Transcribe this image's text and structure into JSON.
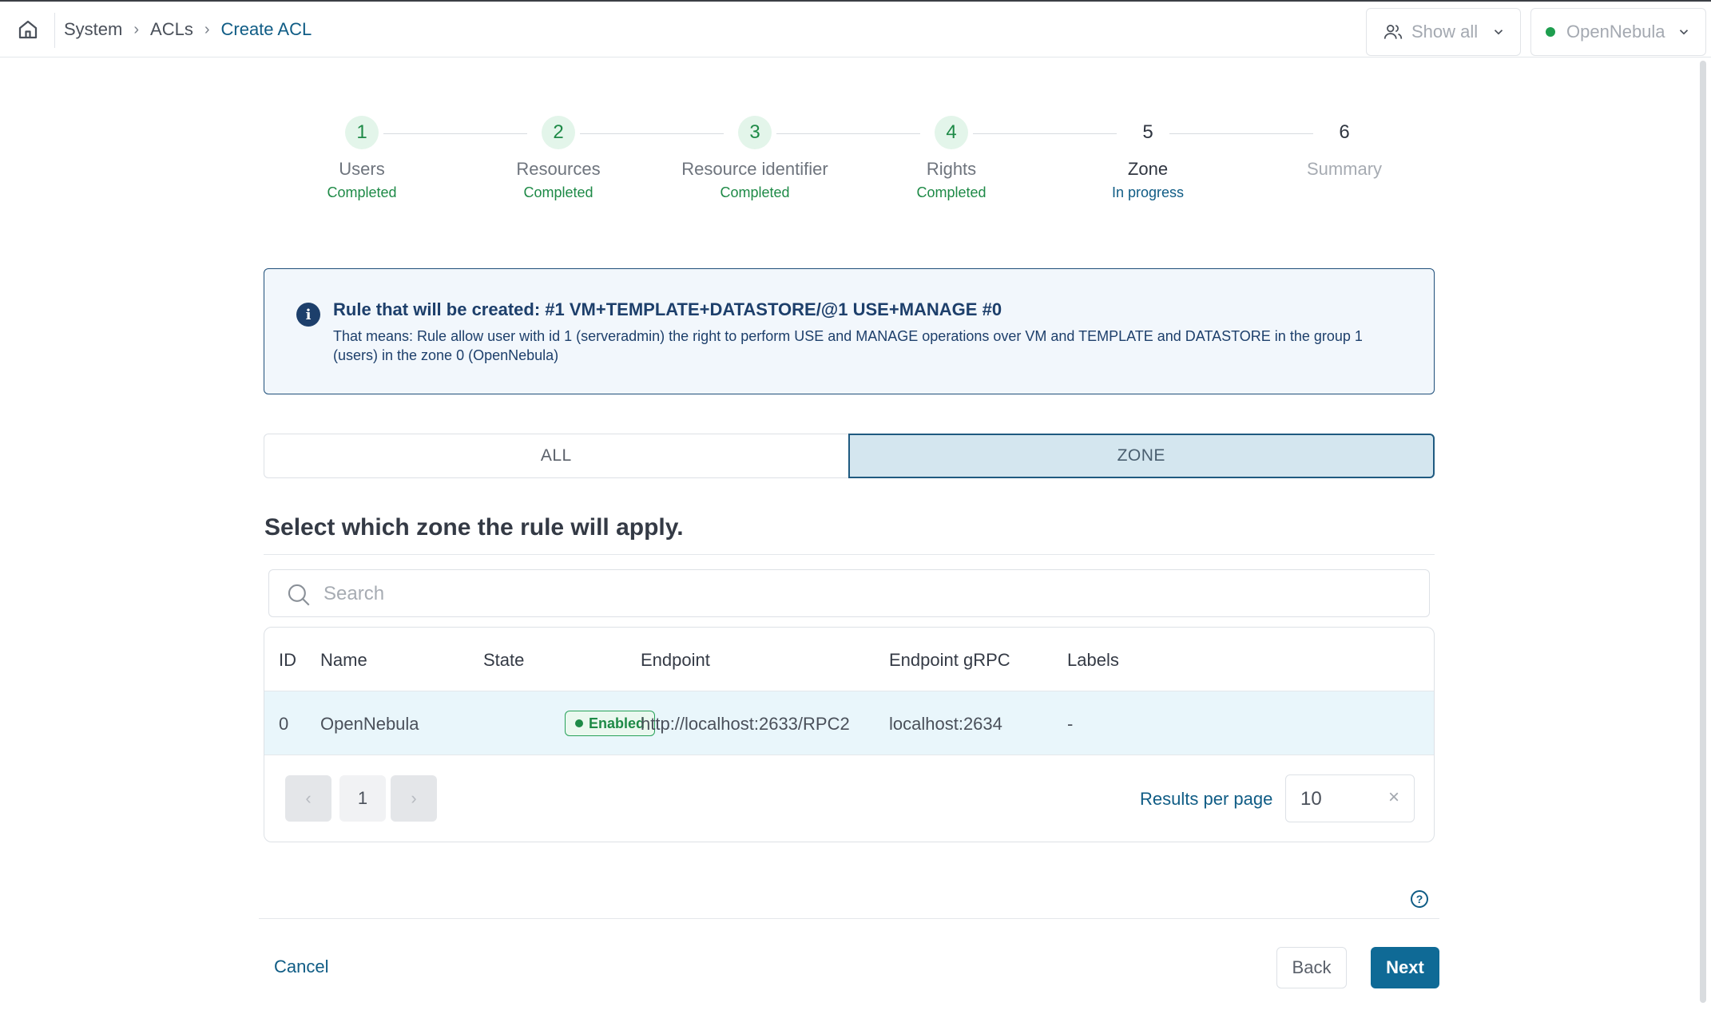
{
  "breadcrumb": {
    "items": [
      "System",
      "ACLs",
      "Create ACL"
    ]
  },
  "header": {
    "show_all": "Show all",
    "zone": "OpenNebula"
  },
  "steps": [
    {
      "num": "1",
      "title": "Users",
      "status": "Completed"
    },
    {
      "num": "2",
      "title": "Resources",
      "status": "Completed"
    },
    {
      "num": "3",
      "title": "Resource identifier",
      "status": "Completed"
    },
    {
      "num": "4",
      "title": "Rights",
      "status": "Completed"
    },
    {
      "num": "5",
      "title": "Zone",
      "status": "In progress"
    },
    {
      "num": "6",
      "title": "Summary",
      "status": ""
    }
  ],
  "info": {
    "icon": "i",
    "title": "Rule that will be created: #1 VM+TEMPLATE+DATASTORE/@1 USE+MANAGE #0",
    "text": "That means: Rule allow user with id 1 (serveradmin) the right to perform USE and MANAGE operations over VM and TEMPLATE and DATASTORE in the group 1 (users) in the zone 0 (OpenNebula)"
  },
  "toggle": {
    "all": "ALL",
    "zone": "ZONE"
  },
  "heading": "Select which zone the rule will apply.",
  "search": {
    "placeholder": "Search"
  },
  "table": {
    "columns": [
      "ID",
      "Name",
      "State",
      "Endpoint",
      "Endpoint gRPC",
      "Labels"
    ],
    "rows": [
      {
        "id": "0",
        "name": "OpenNebula",
        "state": "Enabled",
        "endpoint": "http://localhost:2633/RPC2",
        "endpoint_grpc": "localhost:2634",
        "labels": "-"
      }
    ]
  },
  "pagination": {
    "prev": "‹",
    "page": "1",
    "next": "›",
    "results_label": "Results per page",
    "results_value": "10",
    "clear": "×"
  },
  "help": "?",
  "footer": {
    "cancel": "Cancel",
    "back": "Back",
    "next": "Next"
  }
}
